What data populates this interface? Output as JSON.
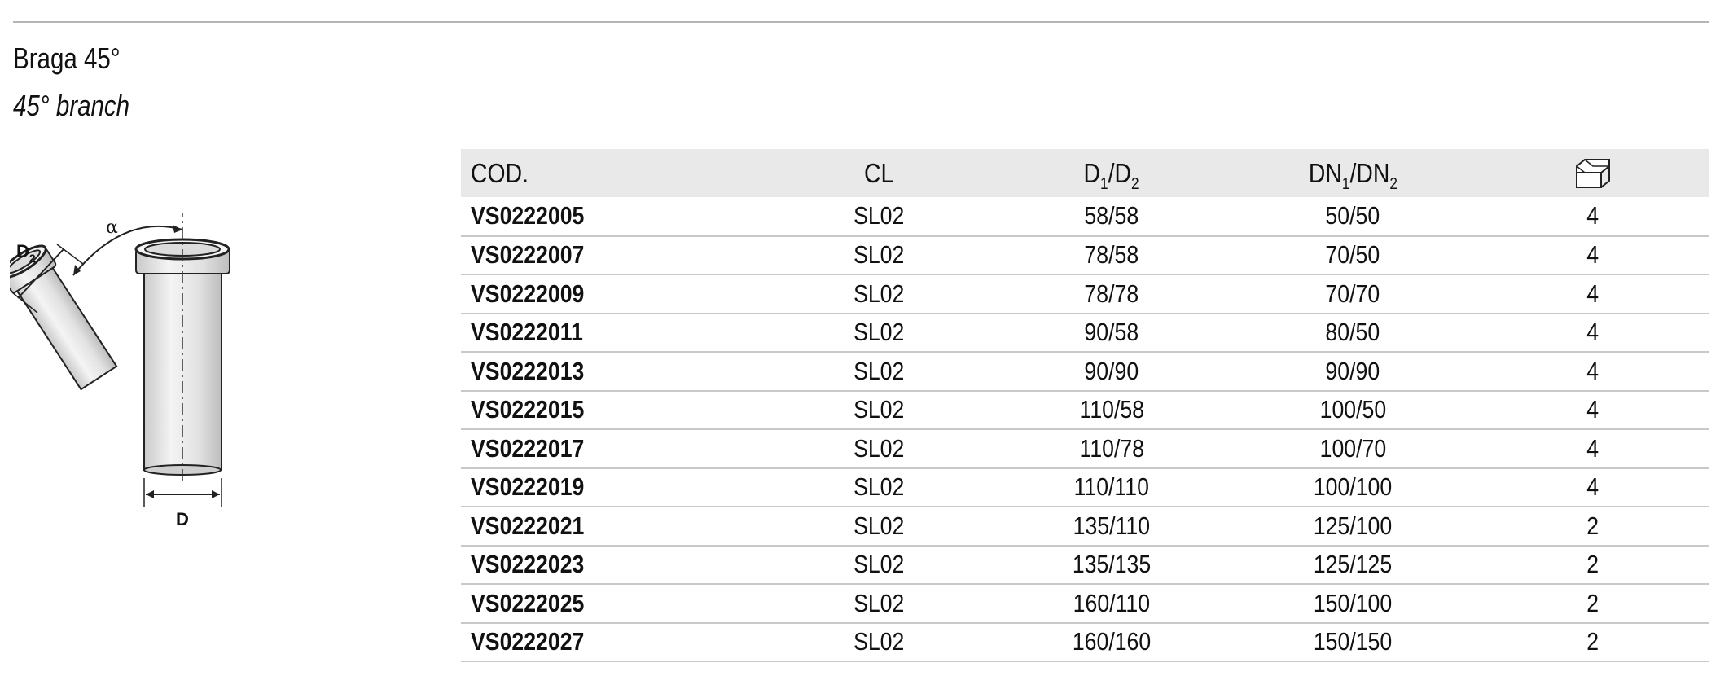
{
  "header": {
    "title": "Braga 45°",
    "subtitle": "45° branch"
  },
  "drawing": {
    "alpha_label": "α",
    "d2_label_main": "D",
    "d2_label_sub": "2",
    "d_label": "D"
  },
  "table": {
    "columns": [
      {
        "main": "COD.",
        "sub": ""
      },
      {
        "main": "CL",
        "sub": ""
      },
      {
        "main": "D",
        "sub": "1",
        "main2": "/D",
        "sub2": "2"
      },
      {
        "main": "DN",
        "sub": "1",
        "main2": "/DN",
        "sub2": "2"
      },
      {
        "icon": "box-icon"
      }
    ],
    "rows": [
      [
        "VS0222005",
        "SL02",
        "58/58",
        "50/50",
        "4"
      ],
      [
        "VS0222007",
        "SL02",
        "78/58",
        "70/50",
        "4"
      ],
      [
        "VS0222009",
        "SL02",
        "78/78",
        "70/70",
        "4"
      ],
      [
        "VS0222011",
        "SL02",
        "90/58",
        "80/50",
        "4"
      ],
      [
        "VS0222013",
        "SL02",
        "90/90",
        "90/90",
        "4"
      ],
      [
        "VS0222015",
        "SL02",
        "110/58",
        "100/50",
        "4"
      ],
      [
        "VS0222017",
        "SL02",
        "110/78",
        "100/70",
        "4"
      ],
      [
        "VS0222019",
        "SL02",
        "110/110",
        "100/100",
        "4"
      ],
      [
        "VS0222021",
        "SL02",
        "135/110",
        "125/100",
        "2"
      ],
      [
        "VS0222023",
        "SL02",
        "135/135",
        "125/125",
        "2"
      ],
      [
        "VS0222025",
        "SL02",
        "160/110",
        "150/100",
        "2"
      ],
      [
        "VS0222027",
        "SL02",
        "160/160",
        "150/150",
        "2"
      ]
    ]
  }
}
